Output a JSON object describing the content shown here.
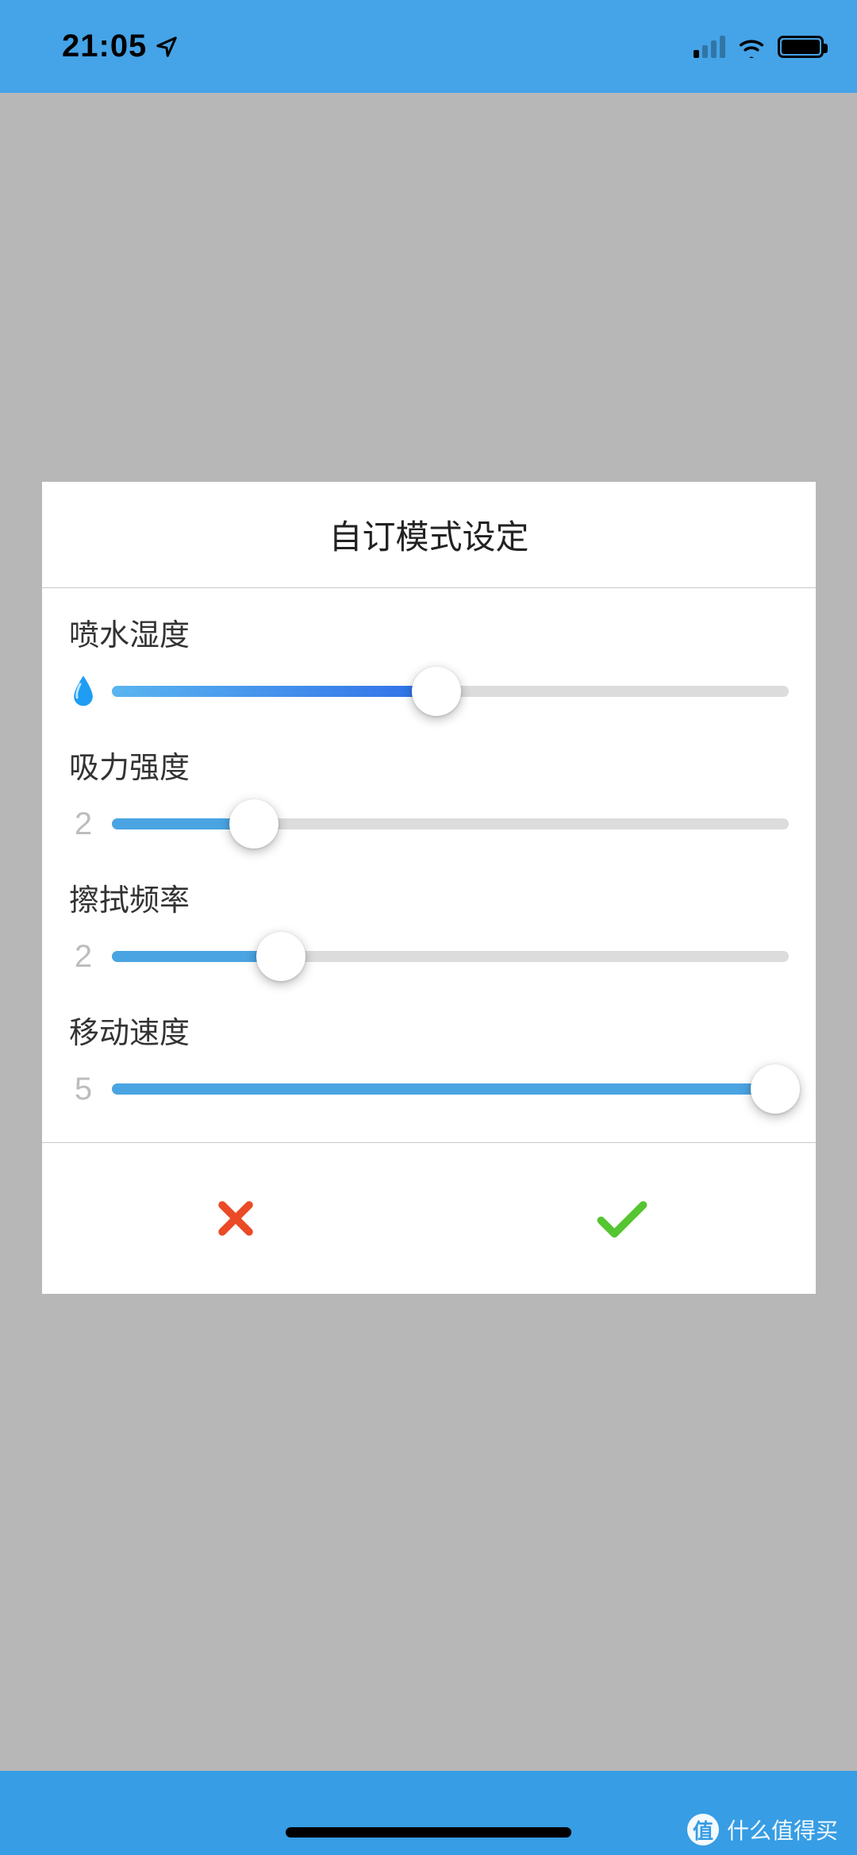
{
  "status_bar": {
    "time": "21:05"
  },
  "dialog": {
    "title": "自订模式设定",
    "sliders": [
      {
        "label": "喷水湿度",
        "prefix_type": "icon",
        "percent": 48,
        "style": "gradient"
      },
      {
        "label": "吸力强度",
        "prefix_type": "value",
        "value": "2",
        "percent": 21,
        "style": "plain"
      },
      {
        "label": "擦拭频率",
        "prefix_type": "value",
        "value": "2",
        "percent": 25,
        "style": "plain"
      },
      {
        "label": "移动速度",
        "prefix_type": "value",
        "value": "5",
        "percent": 98,
        "style": "plain"
      }
    ]
  },
  "watermark": {
    "badge": "值",
    "text": "什么值得买"
  }
}
